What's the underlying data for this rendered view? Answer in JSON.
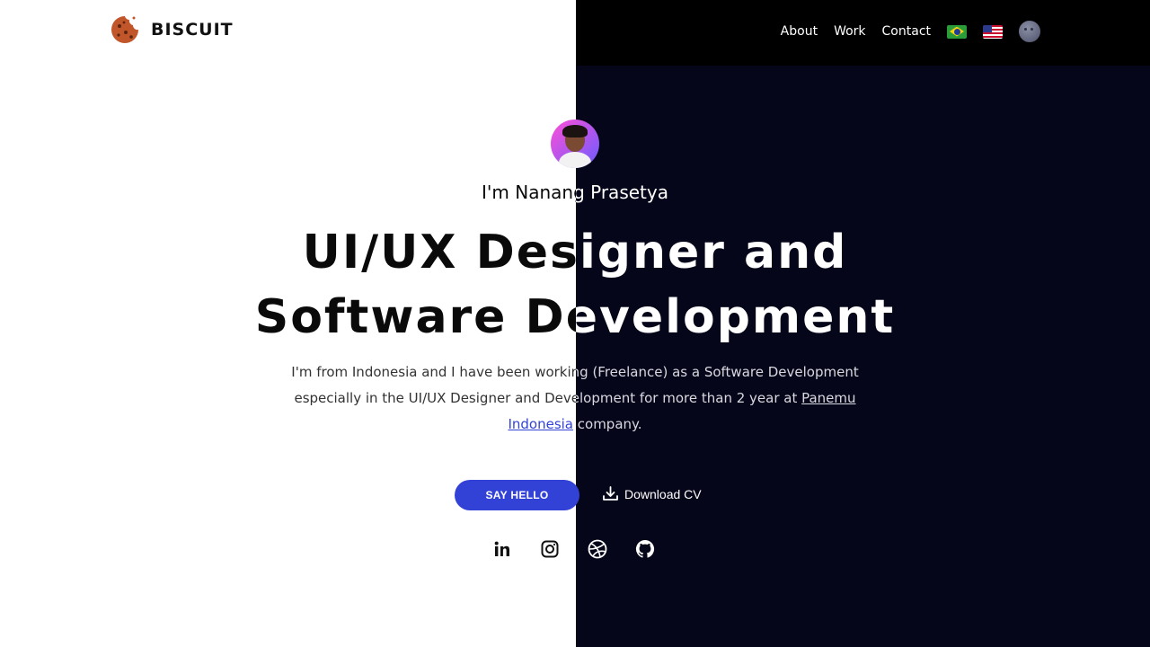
{
  "brand": {
    "name": "BISCUIT",
    "logo_icon": "cookie-icon"
  },
  "nav": {
    "items": [
      "About",
      "Work",
      "Contact"
    ],
    "languages": [
      {
        "code": "pt-BR",
        "icon": "brazil-flag-icon"
      },
      {
        "code": "en-US",
        "icon": "usa-flag-icon"
      }
    ],
    "theme_toggle_icon": "moon-icon"
  },
  "hero": {
    "intro": "I'm Nanang Prasetya",
    "headline_line1": "UI/UX Designer and",
    "headline_line2": "Software Development",
    "description_prefix": "I'm from Indonesia and I have been working (Freelance) as a Software Development especially in the UI/UX Designer and Development for more than 2 year at ",
    "company_link_part1": "Panemu",
    "company_link_part2": "Indonesia",
    "description_suffix": " company.",
    "primary_button": "SAY HELLO",
    "secondary_button": "Download CV"
  },
  "socials": [
    "linkedin-icon",
    "instagram-icon",
    "dribbble-icon",
    "github-icon"
  ],
  "colors": {
    "accent": "#3342d6",
    "dark_bg": "#06061a",
    "header_dark": "#000000",
    "light_bg": "#ffffff"
  }
}
